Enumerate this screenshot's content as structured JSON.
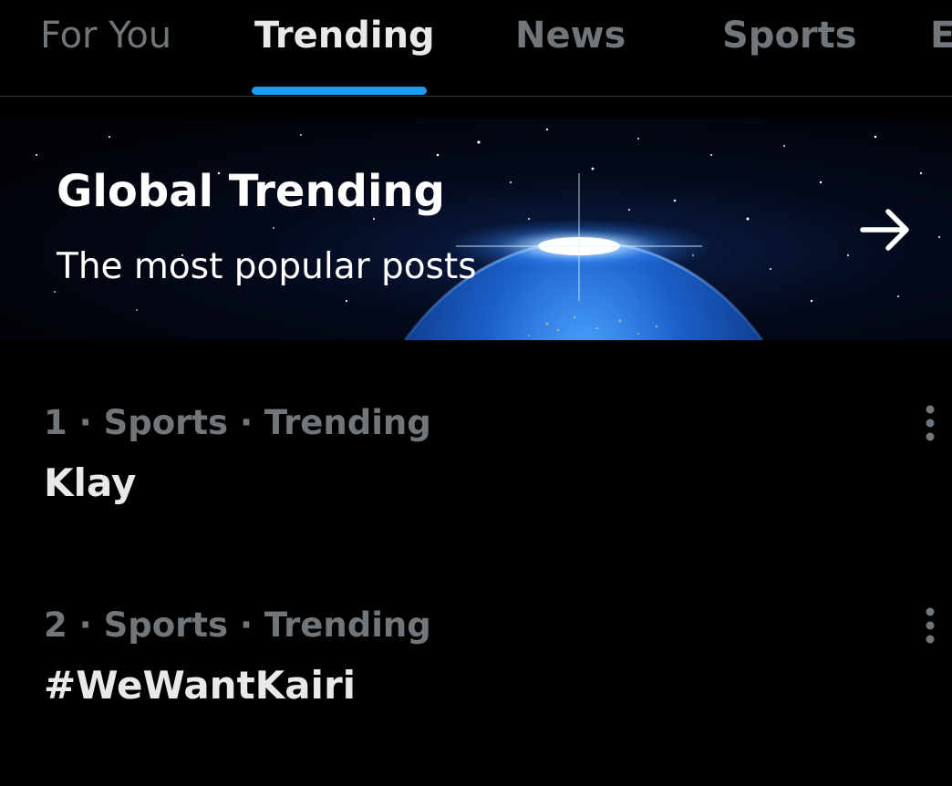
{
  "tabs": [
    {
      "label": "For You",
      "active": false
    },
    {
      "label": "Trending",
      "active": true
    },
    {
      "label": "News",
      "active": false
    },
    {
      "label": "Sports",
      "active": false
    },
    {
      "label": "E",
      "active": false
    }
  ],
  "colors": {
    "background": "#000000",
    "accent": "#1d9bf0",
    "primary_text": "#e7e9ea",
    "secondary_text": "#71767b",
    "divider": "#2f3336"
  },
  "banner": {
    "title": "Global Trending",
    "subtitle": "The most popular posts",
    "arrow_icon": "arrow-right-icon",
    "background_image": "earth-from-space"
  },
  "trends": [
    {
      "meta": "1 · Sports · Trending",
      "name": "Klay",
      "menu_icon": "more-vertical-icon"
    },
    {
      "meta": "2 · Sports · Trending",
      "name": "#WeWantKairi",
      "menu_icon": "more-vertical-icon"
    }
  ]
}
